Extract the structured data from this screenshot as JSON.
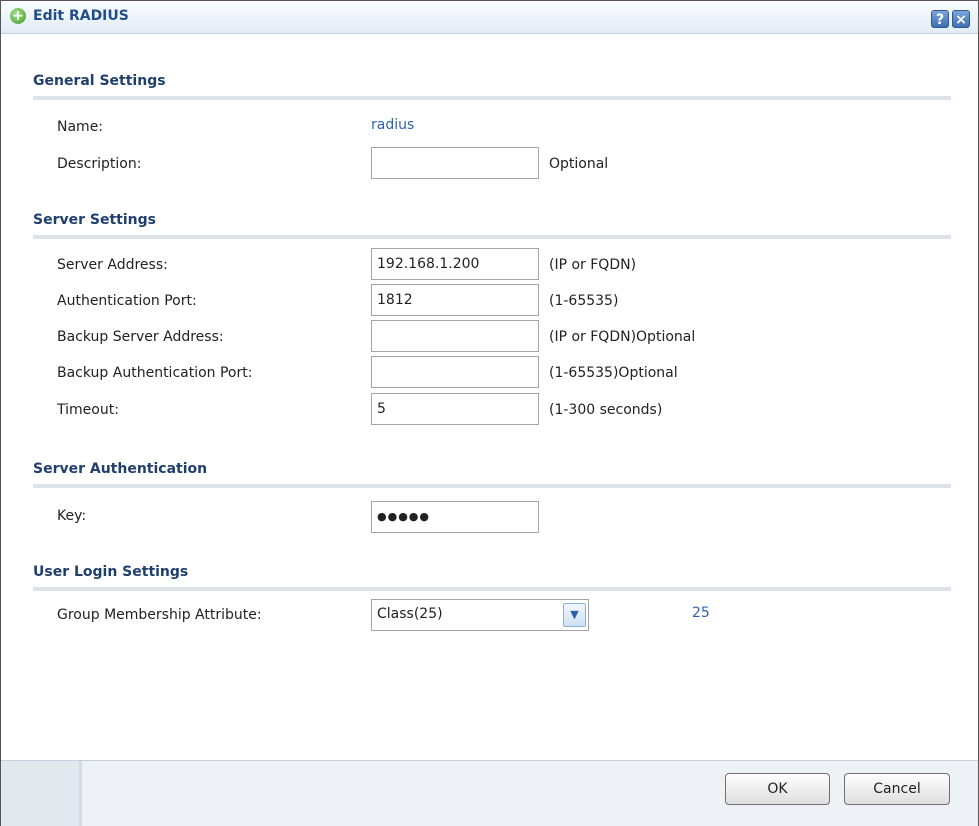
{
  "dialog": {
    "title": "Edit RADIUS",
    "help_label": "?",
    "close_label": "×"
  },
  "general": {
    "heading": "General Settings",
    "name_label": "Name:",
    "name_value": "radius",
    "description_label": "Description:",
    "description_value": "",
    "description_hint": "Optional"
  },
  "server": {
    "heading": "Server Settings",
    "address_label": "Server Address:",
    "address_value": "192.168.1.200",
    "address_hint": "(IP or FQDN)",
    "auth_port_label": "Authentication Port:",
    "auth_port_value": "1812",
    "auth_port_hint": "(1-65535)",
    "backup_address_label": "Backup Server Address:",
    "backup_address_value": "",
    "backup_address_hint": "(IP or FQDN)Optional",
    "backup_port_label": "Backup Authentication Port:",
    "backup_port_value": "",
    "backup_port_hint": "(1-65535)Optional",
    "timeout_label": "Timeout:",
    "timeout_value": "5",
    "timeout_hint": "(1-300 seconds)"
  },
  "auth": {
    "heading": "Server Authentication",
    "key_label": "Key:",
    "key_value": "●●●●●"
  },
  "login": {
    "heading": "User Login Settings",
    "group_label": "Group Membership Attribute:",
    "group_selected": "Class(25)",
    "group_code": "25"
  },
  "footer": {
    "ok_label": "OK",
    "cancel_label": "Cancel"
  }
}
